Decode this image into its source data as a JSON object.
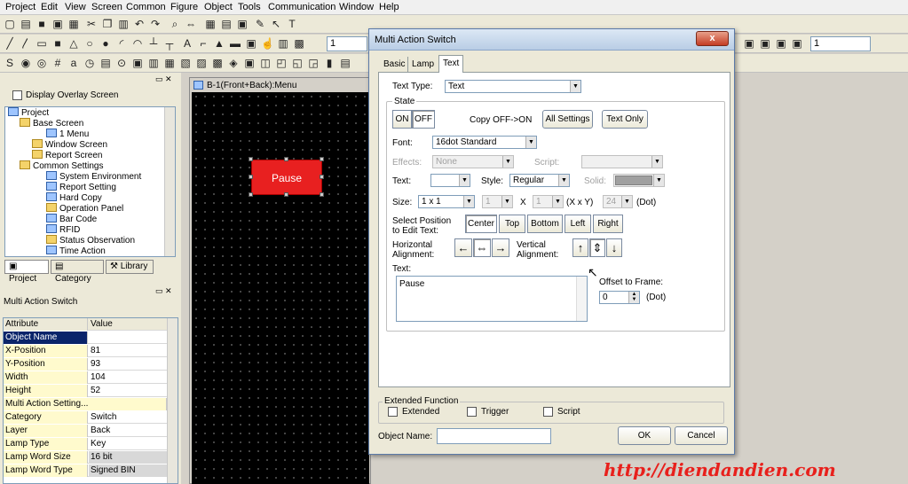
{
  "menu": [
    "Project",
    "Edit",
    "View",
    "Screen",
    "Common",
    "Figure",
    "Object",
    "Tools",
    "Communication",
    "Window",
    "Help"
  ],
  "toolbar": {
    "zoom_value": "1",
    "combo2_value": "1"
  },
  "left_panel": {
    "display_overlay_label": "Display Overlay Screen",
    "tree": [
      {
        "label": "Project",
        "indent": 0,
        "icon": "project-icon"
      },
      {
        "label": "Base Screen",
        "indent": 1,
        "icon": "folder-icon"
      },
      {
        "label": "1 Menu",
        "indent": 2,
        "icon": "screen-icon"
      },
      {
        "label": "Window Screen",
        "indent": 1,
        "icon": "folder-icon"
      },
      {
        "label": "Report Screen",
        "indent": 1,
        "icon": "folder-icon"
      },
      {
        "label": "Common Settings",
        "indent": 1,
        "icon": "folder-icon"
      },
      {
        "label": "System Environment",
        "indent": 2,
        "icon": "system-icon"
      },
      {
        "label": "Report Setting",
        "indent": 2,
        "icon": "report-icon"
      },
      {
        "label": "Hard Copy",
        "indent": 2,
        "icon": "printer-icon"
      },
      {
        "label": "Operation Panel",
        "indent": 2,
        "icon": "panel-icon"
      },
      {
        "label": "Bar Code",
        "indent": 2,
        "icon": "barcode-icon"
      },
      {
        "label": "RFID",
        "indent": 2,
        "icon": "rfid-icon"
      },
      {
        "label": "Status Observation",
        "indent": 2,
        "icon": "status-icon"
      },
      {
        "label": "Time Action",
        "indent": 2,
        "icon": "time-icon"
      }
    ],
    "tabs": [
      "Project",
      "Category",
      "Library"
    ],
    "props_title": "Multi Action Switch",
    "props_header": {
      "attr": "Attribute",
      "value": "Value"
    },
    "props": [
      {
        "attr": "Object Name",
        "value": ""
      },
      {
        "attr": "X-Position",
        "value": "81"
      },
      {
        "attr": "Y-Position",
        "value": "93"
      },
      {
        "attr": "Width",
        "value": "104"
      },
      {
        "attr": "Height",
        "value": "52"
      },
      {
        "attr": "Multi Action Setting...",
        "value": ""
      },
      {
        "attr": "Category",
        "value": "Switch"
      },
      {
        "attr": "Layer",
        "value": "Back"
      },
      {
        "attr": "Lamp Type",
        "value": "Key"
      },
      {
        "attr": "Lamp Word Size",
        "value": "16 bit"
      },
      {
        "attr": "Lamp Word Type",
        "value": "Signed BIN"
      }
    ]
  },
  "canvas": {
    "title": "B-1(Front+Back):Menu",
    "button_label": "Pause",
    "button_color": "#e82020"
  },
  "dialog": {
    "title": "Multi Action Switch",
    "close_label": "x",
    "tabs": [
      "Basic",
      "Lamp",
      "Text"
    ],
    "text_type_label": "Text Type:",
    "text_type_value": "Text",
    "state_label": "State",
    "on_label": "ON",
    "off_label": "OFF",
    "copy_label": "Copy OFF->ON",
    "all_settings_label": "All Settings",
    "text_only_label": "Text Only",
    "font_label": "Font:",
    "font_value": "16dot Standard",
    "effects_label": "Effects:",
    "effects_value": "None",
    "script_label": "Script:",
    "text_color_label": "Text:",
    "style_label": "Style:",
    "style_value": "Regular",
    "solid_label": "Solid:",
    "size_label": "Size:",
    "size_value": "1 x 1",
    "size_x_value": "1",
    "x_label": "X",
    "size_y_value": "1",
    "xy_label": "(X x Y)",
    "dot_value": "24",
    "dot_label": "(Dot)",
    "select_pos_label": "Select Position to Edit Text:",
    "pos_center": "Center",
    "pos_top": "Top",
    "pos_bottom": "Bottom",
    "pos_left": "Left",
    "pos_right": "Right",
    "horiz_label": "Horizontal Alignment:",
    "vert_label": "Vertical Alignment:",
    "text_label": "Text:",
    "text_value": "Pause",
    "offset_label": "Offset to Frame:",
    "offset_value": "0",
    "offset_unit": "(Dot)",
    "ext_label": "Extended Function",
    "ext_extended": "Extended",
    "ext_trigger": "Trigger",
    "ext_script": "Script",
    "object_name_label": "Object Name:",
    "ok_label": "OK",
    "cancel_label": "Cancel"
  },
  "watermark": "http://diendandien.com"
}
